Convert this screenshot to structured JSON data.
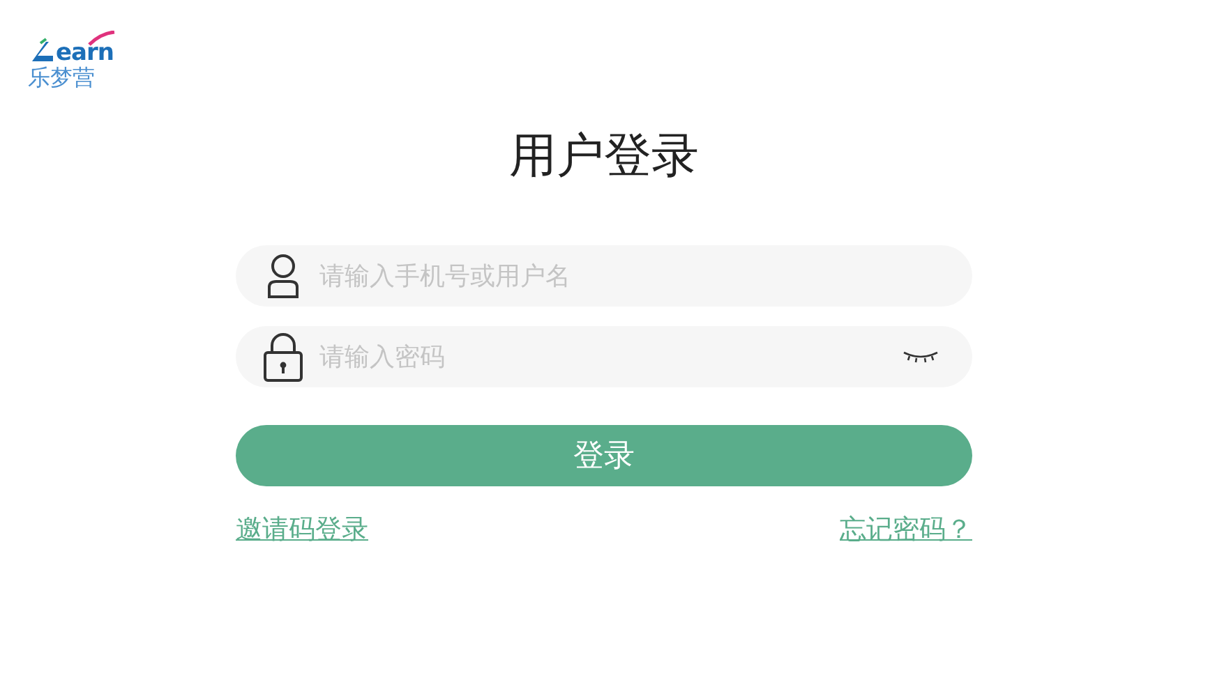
{
  "logo": {
    "wordmark": "earn",
    "name": "乐梦营"
  },
  "title": "用户登录",
  "fields": [
    {
      "kind": "account",
      "placeholder": "请输入手机号或用户名"
    },
    {
      "kind": "password",
      "placeholder": "请输入密码",
      "password_visible": false
    }
  ],
  "login_button": "登录",
  "links": [
    {
      "label": "邀请码登录"
    },
    {
      "label": "忘记密码？"
    }
  ]
}
